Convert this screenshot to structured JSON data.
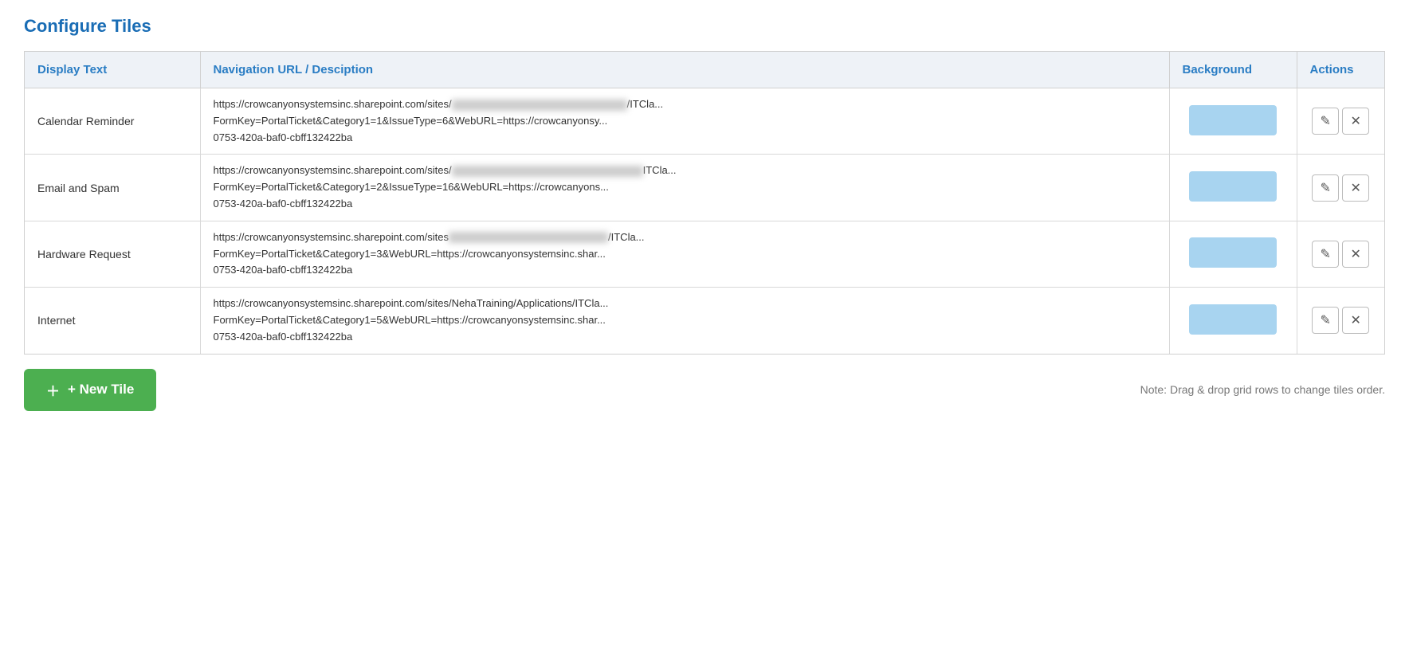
{
  "page": {
    "title": "Configure Tiles"
  },
  "table": {
    "headers": {
      "display_text": "Display Text",
      "nav_url": "Navigation URL / Desciption",
      "background": "Background",
      "actions": "Actions"
    },
    "rows": [
      {
        "id": 1,
        "display_text": "Calendar Reminder",
        "url_line1": "https://crowcanyonsystemsinc.sharepoint.com/sites/",
        "url_line1_blur": "[blurred-path]",
        "url_line1_suffix": "/ITCla...",
        "url_line2": "FormKey=PortalTicket&Category1=1&IssueType=6&WebURL=https://crowcanyonsy...",
        "url_line3": "0753-420a-baf0-cbff132422ba",
        "bg_color": "#a8d4f0"
      },
      {
        "id": 2,
        "display_text": "Email and Spam",
        "url_line1": "https://crowcanyonsystemsinc.sharepoint.com/sites/",
        "url_line1_blur": "[blurred-path]",
        "url_line1_suffix": "ITCla...",
        "url_line2": "FormKey=PortalTicket&Category1=2&IssueType=16&WebURL=https://crowcanyons...",
        "url_line3": "0753-420a-baf0-cbff132422ba",
        "bg_color": "#a8d4f0"
      },
      {
        "id": 3,
        "display_text": "Hardware Request",
        "url_line1": "https://crowcanyonsystemsinc.sharepoint.com/sites",
        "url_line1_blur": "[blurred-path]",
        "url_line1_suffix": "/ITCla...",
        "url_line2": "FormKey=PortalTicket&Category1=3&WebURL=https://crowcanyonsystemsinc.shar...",
        "url_line3": "0753-420a-baf0-cbff132422ba",
        "bg_color": "#a8d4f0"
      },
      {
        "id": 4,
        "display_text": "Internet",
        "url_line1": "https://crowcanyonsystemsinc.sharepoint.com/sites/NehaTraining/Applications/ITCla...",
        "url_line1_blur": "",
        "url_line1_suffix": "",
        "url_line2": "FormKey=PortalTicket&Category1=5&WebURL=https://crowcanyonsystemsinc.shar...",
        "url_line3": "0753-420a-baf0-cbff132422ba",
        "bg_color": "#a8d4f0"
      }
    ]
  },
  "footer": {
    "new_tile_label": "+ New Tile",
    "note": "Note: Drag & drop grid rows to change tiles order."
  },
  "icons": {
    "edit": "✎",
    "delete": "✕",
    "plus": "+"
  }
}
